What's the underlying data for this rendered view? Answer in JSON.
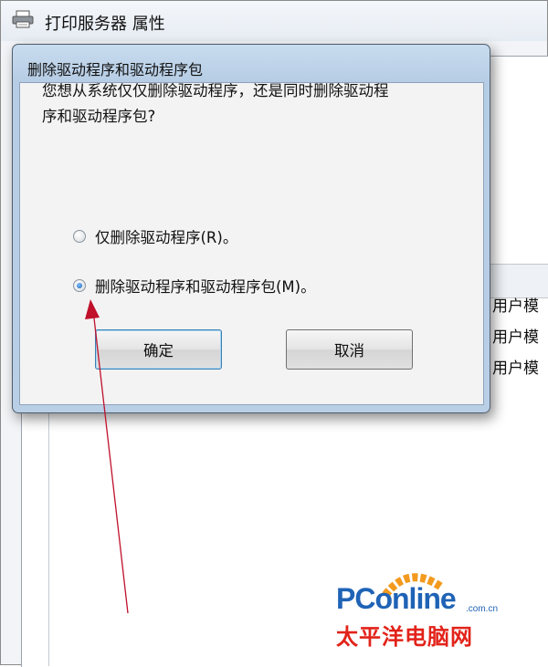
{
  "background_window": {
    "title": "打印服务器 属性",
    "icon": "printer-icon",
    "row_texts": [
      "用户模",
      "用户模",
      "用户模"
    ]
  },
  "dialog": {
    "title": "删除驱动程序和驱动程序包",
    "question": "您想从系统仅仅删除驱动程序，还是同时删除驱动程序序和驱动程序包？",
    "question_line1": "您想从系统仅仅删除驱动程序，还是同时删除驱动程",
    "question_line2": "序和驱动程序包?",
    "options": [
      {
        "label": "仅删除驱动程序(R)。",
        "checked": false
      },
      {
        "label": "删除驱动程序和驱动程序包(M)。",
        "checked": true
      }
    ],
    "ok_label": "确定",
    "cancel_label": "取消"
  },
  "annotation": {
    "type": "arrow",
    "color": "#c0102a",
    "points_to": "delete-driver-and-package-radio"
  },
  "watermark": {
    "brand": "PConline",
    "domain": ".com.cn",
    "chinese": "太平洋电脑网",
    "brand_color": "#1f63b6",
    "chinese_color": "#e2231a"
  }
}
